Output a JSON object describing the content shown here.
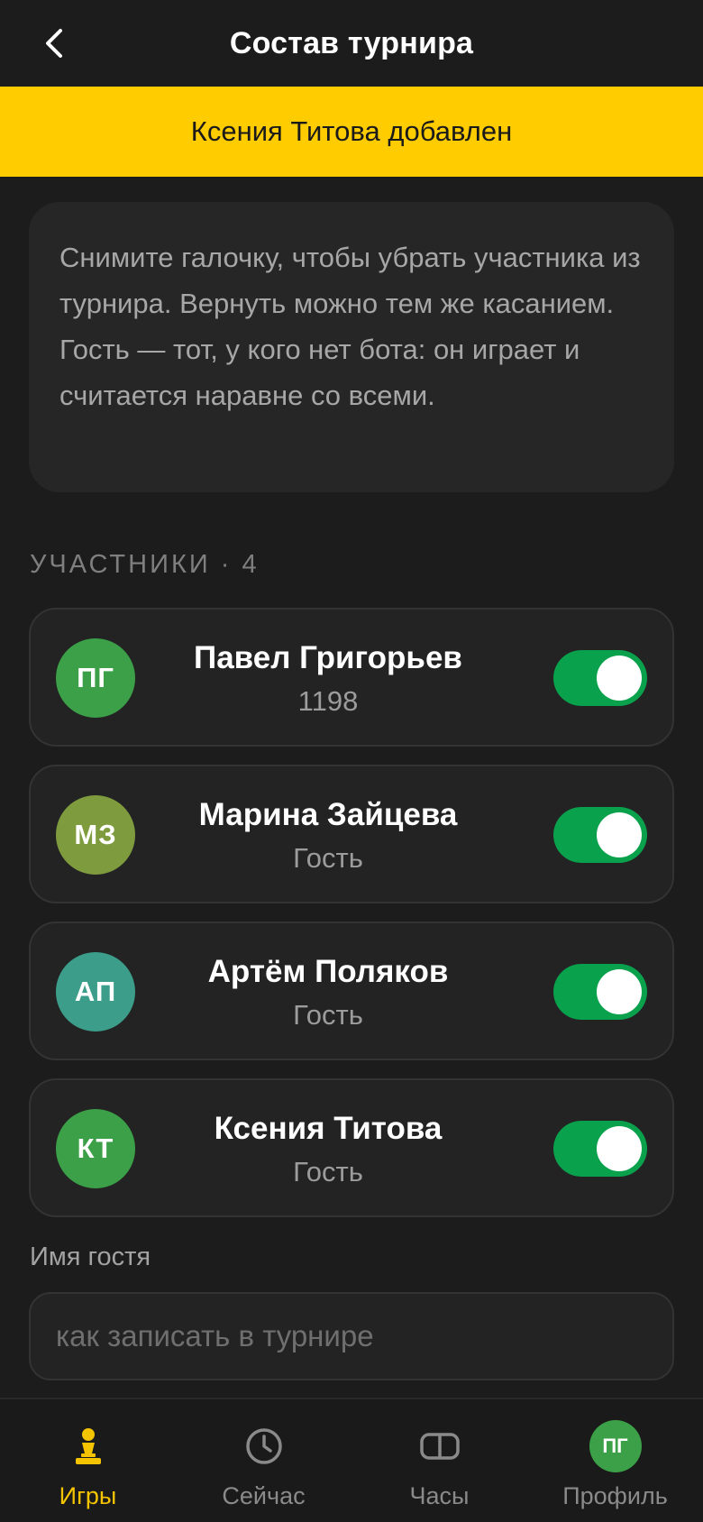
{
  "header": {
    "title": "Состав турнира",
    "back_icon": "chevron-left-icon"
  },
  "toast": {
    "message": "Ксения Титова добавлен",
    "color": "#ffcc00"
  },
  "hint": {
    "text": "Снимите галочку, чтобы убрать участника из турнира. Вернуть можно тем же касанием. Гость — тот, у кого нет бота: он играет и считается наравне со всеми."
  },
  "participants": {
    "section_label": "УЧАСТНИКИ · 4",
    "items": [
      {
        "initials": "ПГ",
        "name": "Павел Григорьев",
        "subtitle": "1198",
        "avatar_color": "#3ca048",
        "enabled": true
      },
      {
        "initials": "МЗ",
        "name": "Марина Зайцева",
        "subtitle": "Гость",
        "avatar_color": "#7e9c3e",
        "enabled": true
      },
      {
        "initials": "АП",
        "name": "Артём Поляков",
        "subtitle": "Гость",
        "avatar_color": "#3c9e8a",
        "enabled": true
      },
      {
        "initials": "КТ",
        "name": "Ксения Титова",
        "subtitle": "Гость",
        "avatar_color": "#3ca048",
        "enabled": true
      }
    ]
  },
  "guest": {
    "label": "Имя гостя",
    "value": "",
    "placeholder": "как записать в турнире"
  },
  "nav": {
    "items": [
      {
        "label": "Игры",
        "icon": "pawn-icon",
        "active": true
      },
      {
        "label": "Сейчас",
        "icon": "clock-icon",
        "active": false
      },
      {
        "label": "Часы",
        "icon": "chess-clock-icon",
        "active": false
      },
      {
        "label": "Профиль",
        "icon": "profile-avatar",
        "initials": "ПГ",
        "active": false
      }
    ]
  },
  "colors": {
    "accent": "#f5c400",
    "toggle_on": "#0aa14d",
    "background": "#1c1c1c",
    "card": "#232323"
  }
}
